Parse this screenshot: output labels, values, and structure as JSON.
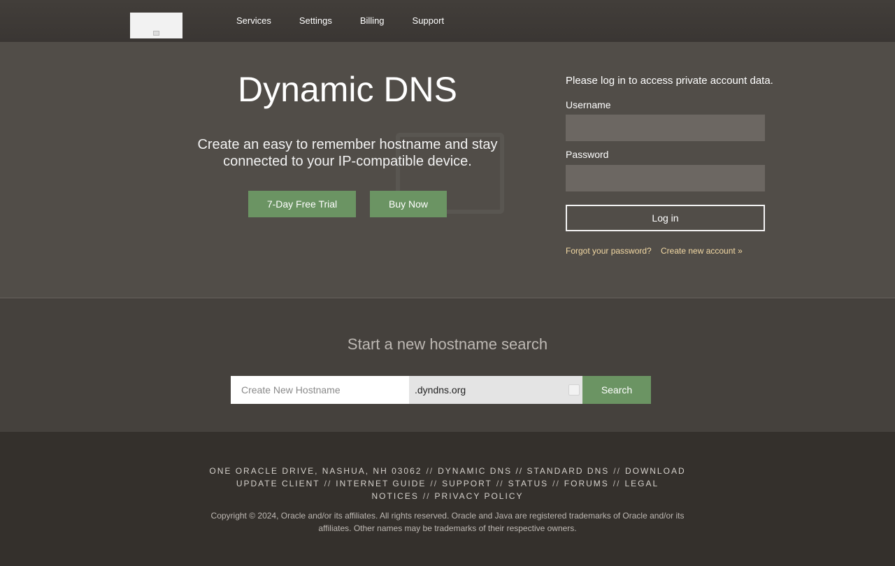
{
  "nav": {
    "items": [
      "Services",
      "Settings",
      "Billing",
      "Support"
    ]
  },
  "hero": {
    "title": "Dynamic DNS",
    "subtitle": "Create an easy to remember hostname and stay connected to your IP-compatible device.",
    "trial_label": "7-Day Free Trial",
    "buy_label": "Buy Now"
  },
  "login": {
    "note": "Please log in to access private account data.",
    "username_label": "Username",
    "password_label": "Password",
    "username_value": "",
    "password_value": "",
    "login_label": "Log in",
    "forgot_link": "Forgot your password?",
    "create_link": "Create new account »"
  },
  "search": {
    "title": "Start a new hostname search",
    "placeholder": "Create New Hostname",
    "domain_selected": ".dyndns.org",
    "button_label": "Search"
  },
  "footer": {
    "links": [
      "ONE ORACLE DRIVE, NASHUA, NH 03062",
      "DYNAMIC DNS // STANDARD DNS",
      "DOWNLOAD UPDATE CLIENT",
      "INTERNET GUIDE",
      "SUPPORT",
      "STATUS",
      "FORUMS",
      "LEGAL NOTICES",
      "PRIVACY POLICY"
    ],
    "separator": "//",
    "copyright": "Copyright © 2024, Oracle and/or its affiliates. All rights reserved. Oracle and Java are registered trademarks of Oracle and/or its affiliates. Other names may be trademarks of their respective owners."
  },
  "colors": {
    "accent_green": "#6b9463",
    "link_tan": "#f3d9a4",
    "hero_bg": "#514d48",
    "footer_bg": "#34302c"
  }
}
